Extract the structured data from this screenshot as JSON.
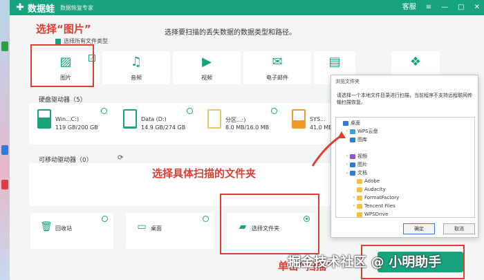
{
  "app": {
    "logo_text": "数据蛙",
    "logo_subtitle": "数据恢复专家",
    "titlebar_right": [
      "客服",
      "≡",
      "—",
      "□",
      "✕"
    ]
  },
  "annotations": {
    "select_image": "选择“图片”",
    "select_folder": "选择具体扫描的文件夹",
    "click_scan": "单击“扫描”"
  },
  "header": {
    "subtitle": "选择要扫描的丢失数据的数据类型和路径。",
    "select_all": "选择所有文件类型"
  },
  "file_types": [
    {
      "label": "图片",
      "icon": "image-icon",
      "checked": true
    },
    {
      "label": "音频",
      "icon": "music-icon",
      "checked": false
    },
    {
      "label": "视频",
      "icon": "video-icon",
      "checked": false
    },
    {
      "label": "电子邮件",
      "icon": "mail-icon",
      "checked": false
    },
    {
      "label": "",
      "icon": "document-icon",
      "checked": false
    },
    {
      "label": "",
      "icon": "other-icon",
      "checked": false
    }
  ],
  "hard_drives": {
    "title": "硬盘驱动器（5）",
    "drives": [
      {
        "name": "Win...C:)",
        "size": "119 GB/200 GB",
        "fill": 0.6
      },
      {
        "name": "Data (D:)",
        "size": "14.9 GB/274 GB",
        "fill": 0.05
      },
      {
        "name": "分区...:)",
        "size": "8.0 MB/16.0 MB",
        "fill": 0.5
      },
      {
        "name": "SYS...",
        "size": "41.0 ME",
        "fill": 0.4
      }
    ]
  },
  "removable": {
    "title": "可移动驱动器（0）"
  },
  "locations": [
    {
      "label": "回收站",
      "icon": "recycle-bin-icon",
      "selected": false
    },
    {
      "label": "桌面",
      "icon": "desktop-icon",
      "selected": false
    },
    {
      "label": "选择文件夹",
      "icon": "folder-icon",
      "selected": true
    }
  ],
  "scan_button": "扫描",
  "watermark": "掘金技术社区 @ 小明助手",
  "dialog": {
    "title": "浏览文件夹",
    "message": "请选择一个本地文件目录进行扫描，当前程序不支持远程联网传输扫描恢复。",
    "tree": [
      {
        "label": "桌面",
        "level": 0,
        "expand": "",
        "icon": "blue"
      },
      {
        "label": "WPS云盘",
        "level": 1,
        "expand": "›",
        "icon": "cloud"
      },
      {
        "label": "图库",
        "level": 1,
        "expand": "",
        "icon": "blue"
      },
      {
        "label": "",
        "level": 1,
        "expand": "",
        "icon": ""
      },
      {
        "label": "视频",
        "level": 1,
        "expand": "›",
        "icon": "purple"
      },
      {
        "label": "图片",
        "level": 1,
        "expand": "›",
        "icon": "blue"
      },
      {
        "label": "文档",
        "level": 1,
        "expand": "⌄",
        "icon": "blue"
      },
      {
        "label": "Adobe",
        "level": 2,
        "expand": "",
        "icon": "folder"
      },
      {
        "label": "Audacity",
        "level": 2,
        "expand": "",
        "icon": "folder"
      },
      {
        "label": "FormatFactory",
        "level": 2,
        "expand": "›",
        "icon": "folder"
      },
      {
        "label": "Tencent Files",
        "level": 2,
        "expand": "›",
        "icon": "folder"
      },
      {
        "label": "WPSDrive",
        "level": 2,
        "expand": "",
        "icon": "folder"
      }
    ],
    "ok": "确定",
    "cancel": "取消"
  }
}
